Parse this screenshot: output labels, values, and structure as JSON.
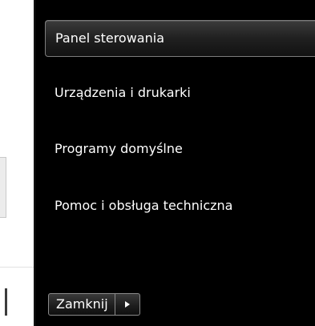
{
  "start_menu": {
    "items": [
      {
        "label": "Panel sterowania",
        "selected": true
      },
      {
        "label": "Urządzenia i drukarki"
      },
      {
        "label": "Programy domyślne"
      },
      {
        "label": "Pomoc i obsługa techniczna"
      }
    ],
    "shutdown": {
      "label": "Zamknij",
      "arrow_icon": "triangle-right-icon"
    }
  },
  "colors": {
    "pane_background": "#000000",
    "text": "#ffffff",
    "selected_border": "#7d7d7d",
    "left_pane_background": "#ffffff"
  }
}
